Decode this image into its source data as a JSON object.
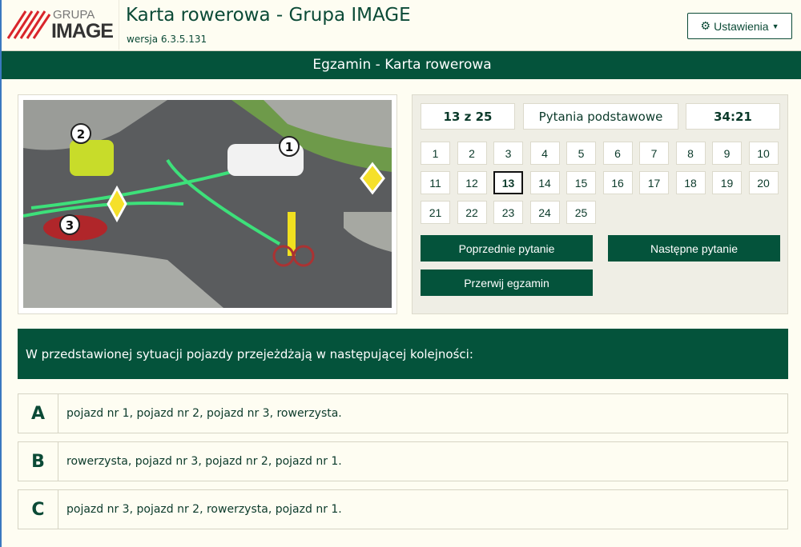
{
  "header": {
    "logo_top": "GRUPA",
    "logo_bottom": "IMAGE",
    "title": "Karta rowerowa - Grupa IMAGE",
    "version": "wersja 6.3.5.131",
    "settings_label": "Ustawienia"
  },
  "bar": {
    "title": "Egzamin - Karta rowerowa"
  },
  "scene": {
    "labels": [
      "1",
      "2",
      "3"
    ]
  },
  "panel": {
    "progress": "13 z 25",
    "category": "Pytania podstawowe",
    "timer": "34:21",
    "numbers": [
      "1",
      "2",
      "3",
      "4",
      "5",
      "6",
      "7",
      "8",
      "9",
      "10",
      "11",
      "12",
      "13",
      "14",
      "15",
      "16",
      "17",
      "18",
      "19",
      "20",
      "21",
      "22",
      "23",
      "24",
      "25"
    ],
    "current": 13,
    "prev_label": "Poprzednie pytanie",
    "next_label": "Następne pytanie",
    "abort_label": "Przerwij egzamin"
  },
  "question": {
    "text": "W przedstawionej sytuacji pojazdy przejeżdżają w następującej kolejności:"
  },
  "answers": [
    {
      "letter": "A",
      "text": "pojazd nr 1, pojazd nr 2, pojazd nr 3, rowerzysta."
    },
    {
      "letter": "B",
      "text": "rowerzysta, pojazd nr 3, pojazd nr 2, pojazd nr 1."
    },
    {
      "letter": "C",
      "text": "pojazd nr 3, pojazd nr 2, rowerzysta, pojazd nr 1."
    }
  ]
}
